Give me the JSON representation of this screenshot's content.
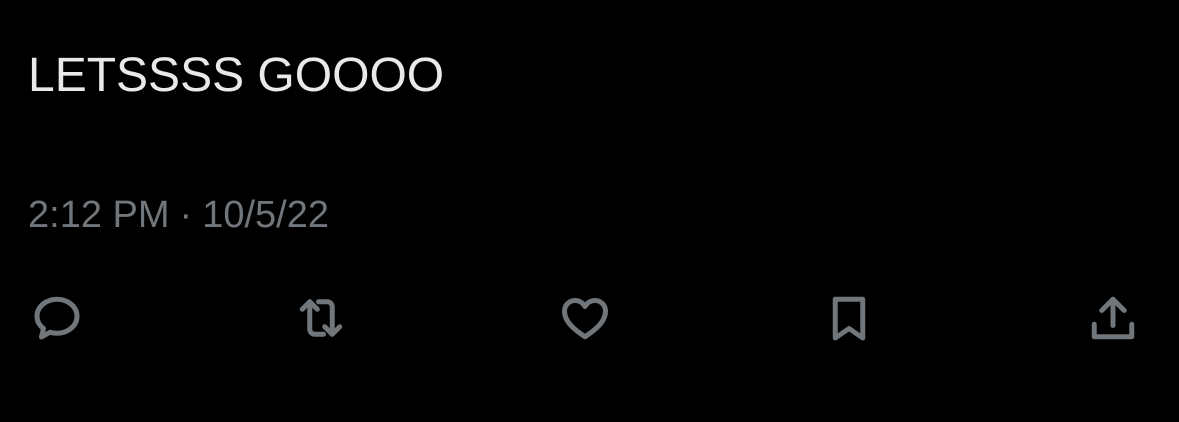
{
  "tweet": {
    "text": "LETSSSS GOOOO",
    "time": "2:12 PM",
    "separator": "·",
    "date": "10/5/22"
  },
  "actions": [
    {
      "name": "reply",
      "icon": "reply-icon"
    },
    {
      "name": "retweet",
      "icon": "retweet-icon"
    },
    {
      "name": "like",
      "icon": "heart-icon"
    },
    {
      "name": "bookmark",
      "icon": "bookmark-icon"
    },
    {
      "name": "share",
      "icon": "share-icon"
    }
  ],
  "colors": {
    "background": "#000000",
    "text": "#e7e9ea",
    "secondary": "#71767b"
  }
}
